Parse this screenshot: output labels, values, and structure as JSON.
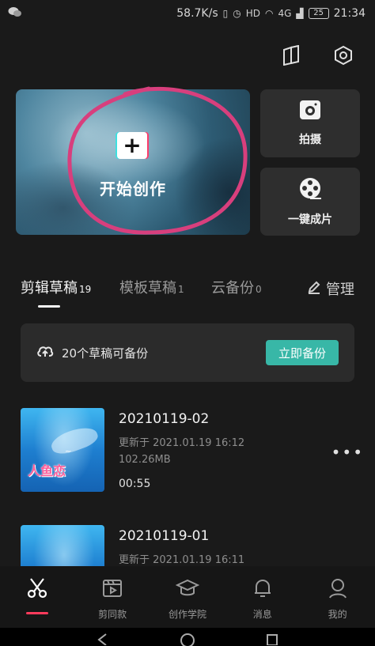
{
  "status_bar": {
    "left_icon": "wechat-icon",
    "speed": "58.7K/s",
    "signal_label": "4G",
    "battery": "25",
    "time": "21:34"
  },
  "top_icons": [
    "tutorial-book-icon",
    "settings-hexagon-icon"
  ],
  "create": {
    "label": "开始创作",
    "plus": "+"
  },
  "actions": [
    {
      "label": "拍摄",
      "icon": "camera-icon"
    },
    {
      "label": "一键成片",
      "icon": "film-reel-icon"
    }
  ],
  "tabs": [
    {
      "label": "剪辑草稿",
      "count": "19"
    },
    {
      "label": "模板草稿",
      "count": "1"
    },
    {
      "label": "云备份",
      "count": "0"
    }
  ],
  "manage": "管理",
  "backup": {
    "text": "20个草稿可备份",
    "button": "立即备份"
  },
  "drafts": [
    {
      "title": "20210119-02",
      "updated": "更新于 2021.01.19 16:12",
      "size": "102.26MB",
      "duration": "00:55",
      "thumb_caption": "人鱼恋"
    },
    {
      "title": "20210119-01",
      "updated": "更新于 2021.01.19 16:11"
    }
  ],
  "bottom_nav": [
    {
      "label": "",
      "icon": "scissors-icon"
    },
    {
      "label": "剪同款",
      "icon": "template-icon"
    },
    {
      "label": "创作学院",
      "icon": "graduation-cap-icon"
    },
    {
      "label": "消息",
      "icon": "bell-icon"
    },
    {
      "label": "我的",
      "icon": "person-icon"
    }
  ],
  "colors": {
    "accent_teal": "#38b7a7",
    "accent_red": "#ff3b5c",
    "background": "#1a1a1a"
  }
}
